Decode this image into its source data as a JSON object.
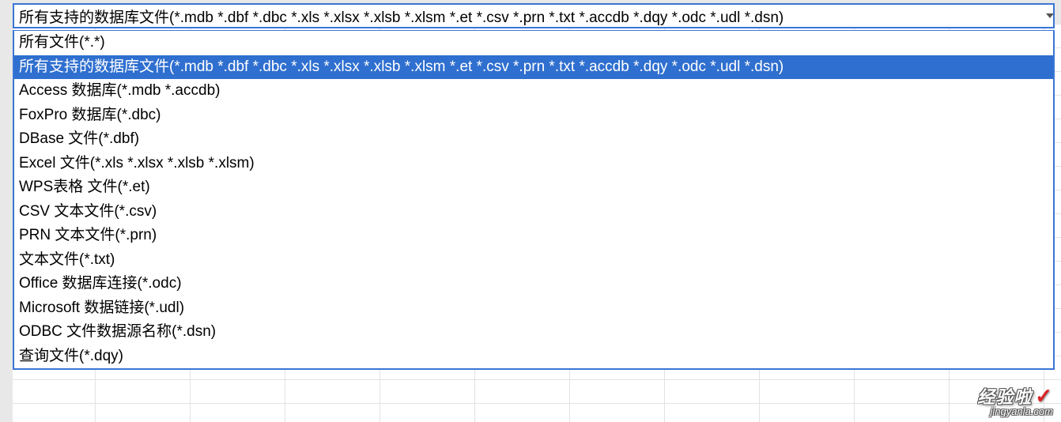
{
  "filetype_filter": {
    "selected": "所有支持的数据库文件(*.mdb *.dbf *.dbc *.xls *.xlsx *.xlsb *.xlsm *.et *.csv *.prn *.txt *.accdb *.dqy *.odc *.udl *.dsn)",
    "selected_index": 1,
    "options": [
      "所有文件(*.*)",
      "所有支持的数据库文件(*.mdb *.dbf *.dbc *.xls *.xlsx *.xlsb *.xlsm *.et *.csv *.prn *.txt *.accdb *.dqy *.odc *.udl *.dsn)",
      "Access 数据库(*.mdb *.accdb)",
      "FoxPro 数据库(*.dbc)",
      "DBase 文件(*.dbf)",
      "Excel 文件(*.xls *.xlsx *.xlsb *.xlsm)",
      "WPS表格 文件(*.et)",
      "CSV 文本文件(*.csv)",
      "PRN 文本文件(*.prn)",
      "文本文件(*.txt)",
      "Office 数据库连接(*.odc)",
      "Microsoft 数据链接(*.udl)",
      "ODBC 文件数据源名称(*.dsn)",
      "查询文件(*.dqy)"
    ]
  },
  "watermark": {
    "title": "经验啦",
    "url": "jingyanla.com",
    "check": "✓"
  }
}
